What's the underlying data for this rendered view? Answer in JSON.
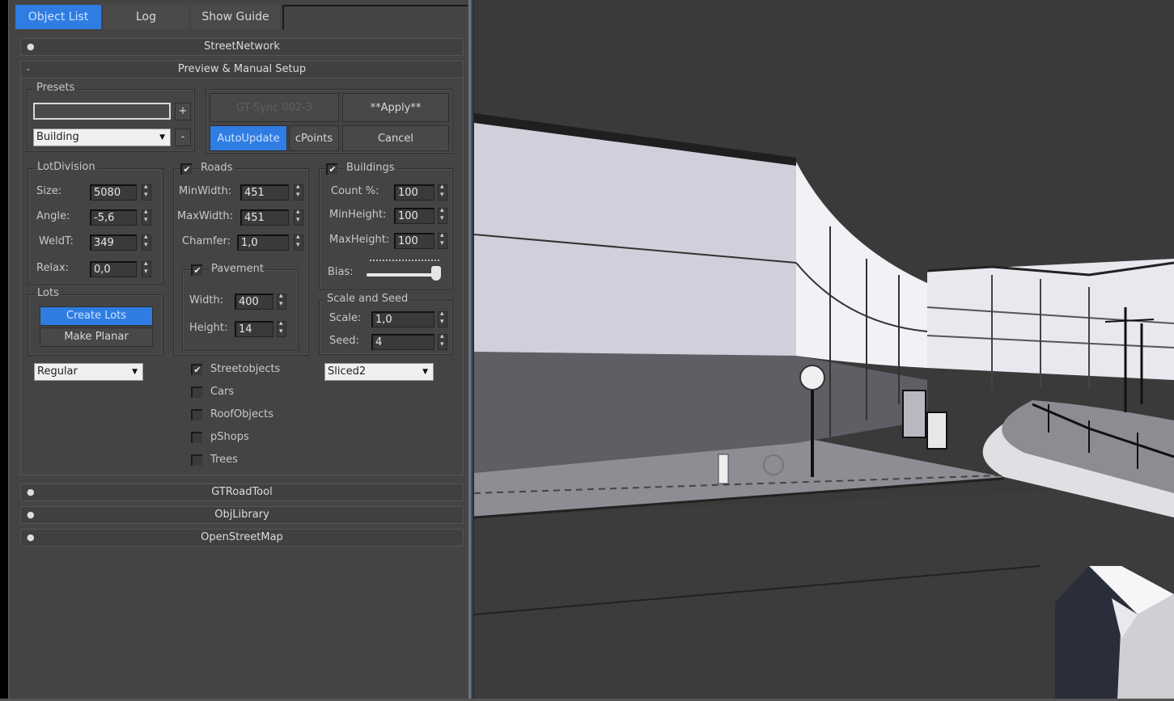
{
  "tabs": [
    {
      "label": "Object List",
      "active": true
    },
    {
      "label": "Log",
      "active": false
    },
    {
      "label": "Show Guide",
      "active": false
    }
  ],
  "rollouts": {
    "street_network": {
      "label": "StreetNetwork",
      "toggle": "+"
    },
    "preview": {
      "label": "Preview & Manual Setup",
      "toggle": "-"
    },
    "gt_road_tool": {
      "label": "GTRoadTool",
      "toggle": "+"
    },
    "obj_library": {
      "label": "ObjLibrary",
      "toggle": "+"
    },
    "open_street_map": {
      "label": "OpenStreetMap",
      "toggle": "+"
    }
  },
  "presets": {
    "title": "Presets",
    "name_value": "",
    "add_label": "+",
    "remove_label": "-",
    "selected": "Building"
  },
  "actions": {
    "sync_label": "GT-Sync 002-3",
    "apply_label": "**Apply**",
    "autoupdate_label": "AutoUpdate",
    "cpoints_label": "cPoints",
    "cancel_label": "Cancel"
  },
  "lot_division": {
    "title": "LotDivision",
    "size_label": "Size:",
    "size_value": "5080",
    "angle_label": "Angle:",
    "angle_value": "-5,6",
    "weld_label": "WeldT:",
    "weld_value": "349",
    "relax_label": "Relax:",
    "relax_value": "0,0"
  },
  "lots": {
    "title": "Lots",
    "create_label": "Create Lots",
    "planar_label": "Make Planar",
    "mode_selected": "Regular"
  },
  "roads": {
    "title": "Roads",
    "checked": true,
    "minwidth_label": "MinWidth:",
    "minwidth_value": "451",
    "maxwidth_label": "MaxWidth:",
    "maxwidth_value": "451",
    "chamfer_label": "Chamfer:",
    "chamfer_value": "1,0"
  },
  "pavement": {
    "title": "Pavement",
    "checked": true,
    "width_label": "Width:",
    "width_value": "400",
    "height_label": "Height:",
    "height_value": "14"
  },
  "buildings": {
    "title": "Buildings",
    "checked": true,
    "count_label": "Count %:",
    "count_value": "100",
    "minheight_label": "MinHeight:",
    "minheight_value": "100",
    "maxheight_label": "MaxHeight:",
    "maxheight_value": "100",
    "bias_label": "Bias:",
    "bias_fraction": 0.95
  },
  "scale_seed": {
    "title": "Scale and Seed",
    "scale_label": "Scale:",
    "scale_value": "1,0",
    "seed_label": "Seed:",
    "seed_value": "4",
    "style_selected": "Sliced2"
  },
  "objects": [
    {
      "label": "Streetobjects",
      "checked": true
    },
    {
      "label": "Cars",
      "checked": false
    },
    {
      "label": "RoofObjects",
      "checked": false
    },
    {
      "label": "pShops",
      "checked": false
    },
    {
      "label": "Trees",
      "checked": false
    }
  ],
  "colors": {
    "accent": "#2f7de3",
    "panel_bg": "#444444",
    "viewport_bg": "#3a3a3a"
  }
}
